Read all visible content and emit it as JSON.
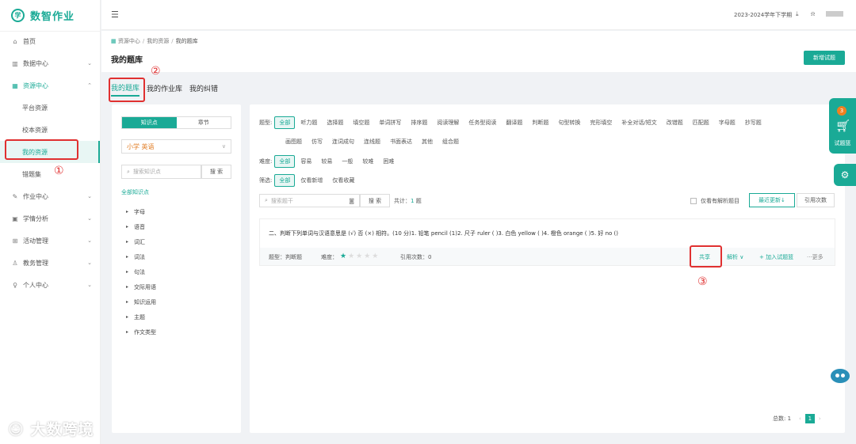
{
  "app": {
    "logo_glyph": "学",
    "title": "数智作业"
  },
  "sidebar": {
    "items": [
      {
        "label": "首页",
        "icon": "home-icon"
      },
      {
        "label": "数据中心",
        "icon": "chart-icon"
      },
      {
        "label": "资源中心",
        "icon": "grid-icon"
      },
      {
        "label": "作业中心",
        "icon": "edit-icon"
      },
      {
        "label": "学情分析",
        "icon": "analysis-icon"
      },
      {
        "label": "活动管理",
        "icon": "activity-icon"
      },
      {
        "label": "教务管理",
        "icon": "admin-icon"
      },
      {
        "label": "个人中心",
        "icon": "user-icon"
      }
    ],
    "resource_sub": [
      "平台资源",
      "校本资源",
      "我的资源",
      "错题集"
    ]
  },
  "topbar": {
    "term": "2023-2024学年下学期"
  },
  "header": {
    "breadcrumb": [
      "资源中心",
      "我的资源",
      "我的题库"
    ],
    "title": "我的题库",
    "new_button": "新增试题"
  },
  "tabs": [
    "我的题库",
    "我的作业库",
    "我的纠错"
  ],
  "left": {
    "seg": [
      "知识点",
      "章节"
    ],
    "grade": "小学 英语",
    "search_placeholder": "搜索知识点",
    "search_button": "搜 索",
    "all_label": "全部知识点",
    "tree": [
      "字母",
      "语音",
      "词汇",
      "词法",
      "句法",
      "交际用语",
      "知识运用",
      "主题",
      "作文类型"
    ]
  },
  "filters": {
    "type_label": "题型:",
    "types_row1": [
      "全部",
      "听力题",
      "选择题",
      "填空题",
      "单词拼写",
      "排序题",
      "阅读理解",
      "任务型阅读",
      "翻译题",
      "判断题",
      "句型转换",
      "完形填空",
      "补全对话/短文",
      "改错题",
      "匹配题",
      "字母题",
      "抄写题"
    ],
    "types_row2": [
      "画图题",
      "仿写",
      "连词成句",
      "连线题",
      "书面表达",
      "其他",
      "组合题"
    ],
    "diff_label": "难度:",
    "diffs": [
      "全部",
      "容易",
      "较易",
      "一般",
      "较难",
      "困难"
    ],
    "screen_label": "筛选:",
    "screens": [
      "全部",
      "仅看新增",
      "仅看收藏"
    ]
  },
  "search": {
    "placeholder": "搜索题干",
    "button": "搜 索",
    "total_label": "共计：",
    "total_count": "1",
    "total_unit": " 题"
  },
  "sort": {
    "only_analysis": "仅看有解析题目",
    "latest": "最近更新↓",
    "cite": "引用次数"
  },
  "question": {
    "text": "二、判断下列单词与汉语意思是 (√) 否 (×) 相符。(10 分)1. 铅笔 pencil (1)2. 尺子 ruler ( )3. 白色 yellow ( )4. 橙色 orange ( )5. 好 no ()",
    "type": "题型：判断题",
    "difficulty_label": "难度：",
    "difficulty_stars": 1,
    "difficulty_max": 5,
    "cite": "引用次数：0",
    "share": "共享",
    "analysis": "解析 ∨",
    "add_basket": "+ 加入试题篮",
    "more": "···更多"
  },
  "pagination": {
    "total": "总数: 1",
    "current": "1"
  },
  "annotations": [
    "①",
    "②",
    "③"
  ],
  "float": {
    "cart_badge": "3",
    "cart_label": "试题篮"
  },
  "watermark": "大数跨境",
  "colors": {
    "accent": "#1aaa96",
    "highlight": "#e03030",
    "grade": "#e07a1f"
  }
}
